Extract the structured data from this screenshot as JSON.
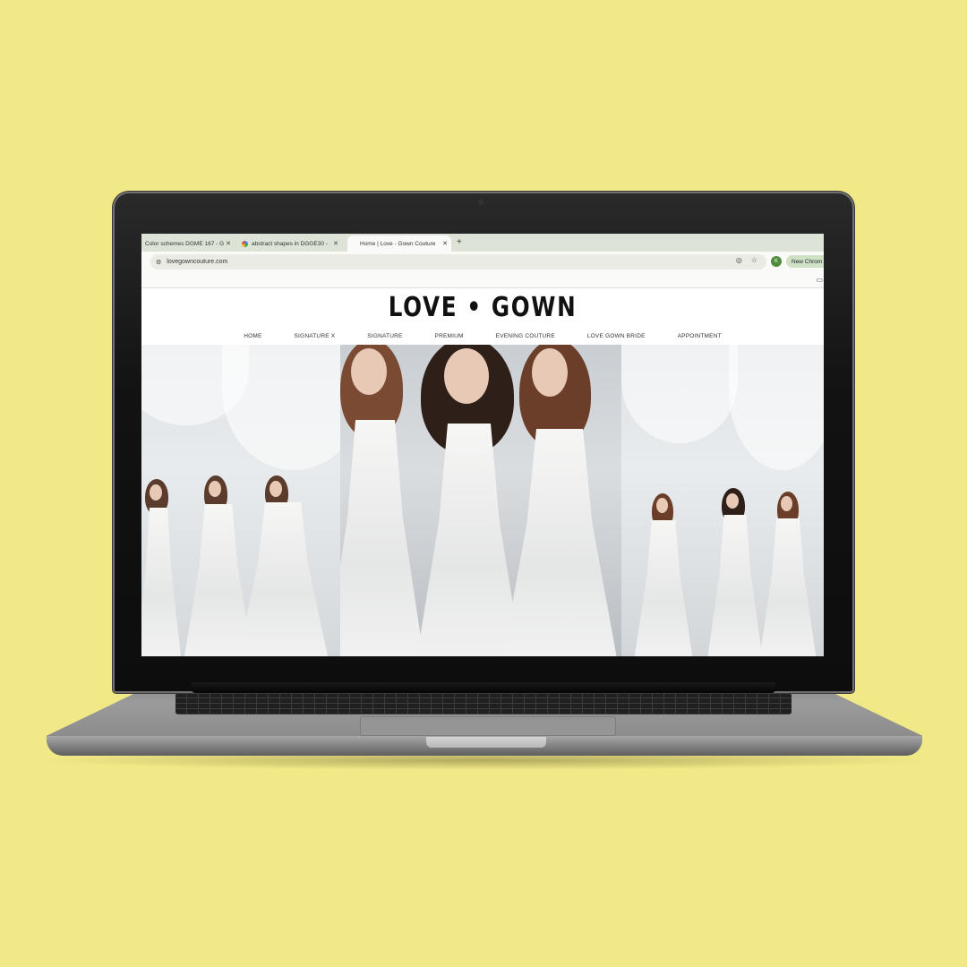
{
  "browser": {
    "tabs": [
      {
        "title": "Color schemes DGME 167 - G",
        "active": false
      },
      {
        "title": "abstract shapes in DGGE30 -",
        "active": false
      },
      {
        "title": "Home | Love - Gown Couture",
        "active": true
      }
    ],
    "new_tab_symbol": "+",
    "url": "lovegowncouture.com",
    "profile_initial": "K",
    "new_chrome_label": "New Chrom"
  },
  "site": {
    "logo": "LOVE • GOWN",
    "nav": [
      "HOME",
      "SIGNATURE X",
      "SIGNATURE",
      "PREMIUM",
      "EVENING COUTURE",
      "LOVE GOWN BRIDE",
      "APPOINTMENT"
    ]
  },
  "colors": {
    "background": "#f1e887",
    "profile": "#4f8a3d",
    "new_chrome_pill": "#cfe2c6"
  }
}
